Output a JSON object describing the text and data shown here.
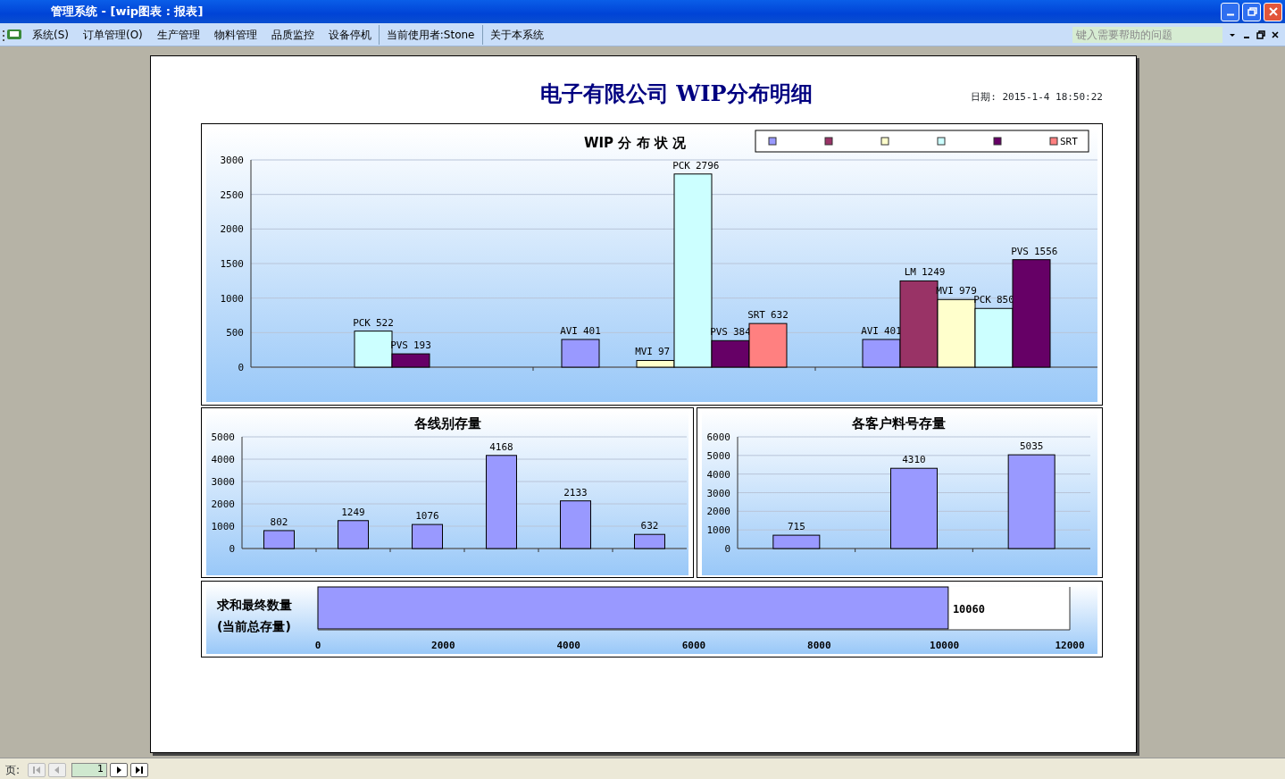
{
  "window": {
    "title": "管理系统 - [wip图表 : 报表]"
  },
  "menu": [
    {
      "label": "系统(S)",
      "kind": "item"
    },
    {
      "label": "订单管理(O)",
      "kind": "item"
    },
    {
      "label": "生产管理",
      "kind": "item"
    },
    {
      "label": "物料管理",
      "kind": "item"
    },
    {
      "label": "品质监控",
      "kind": "item"
    },
    {
      "label": "设备停机",
      "kind": "item"
    },
    {
      "label": "当前使用者:Stone",
      "kind": "sep-item"
    },
    {
      "label": "关于本系统",
      "kind": "sep-item"
    }
  ],
  "help": {
    "placeholder": "键入需要帮助的问题"
  },
  "report": {
    "title": "电子有限公司 WIP分布明细",
    "date": "日期: 2015-1-4 18:50:22",
    "wip_chart": {
      "legend_label": "SRT",
      "chart_data": {
        "type": "bar",
        "title": "WIP 分 布 状 况",
        "data_labels": true,
        "grid": true,
        "yticks": [
          0,
          500,
          1000,
          1500,
          2000,
          2500,
          3000
        ],
        "ylim": [
          0,
          3000
        ],
        "series": [
          {
            "name": "AVI",
            "color": "#9999ff",
            "values": [
              null,
              401,
              401
            ]
          },
          {
            "name": "LM",
            "color": "#993366",
            "values": [
              null,
              null,
              1249
            ]
          },
          {
            "name": "MVI",
            "color": "#ffffcc",
            "values": [
              null,
              97,
              979
            ]
          },
          {
            "name": "PCK",
            "color": "#ccffff",
            "values": [
              522,
              2796,
              850
            ]
          },
          {
            "name": "PVS",
            "color": "#660066",
            "values": [
              193,
              384,
              1556
            ]
          },
          {
            "name": "SRT",
            "color": "#ff8080",
            "values": [
              null,
              632,
              null
            ]
          }
        ]
      }
    },
    "line_chart": {
      "chart_data": {
        "type": "bar",
        "title": "各线别存量",
        "data_labels": true,
        "grid": true,
        "yticks": [
          0,
          1000,
          2000,
          3000,
          4000,
          5000
        ],
        "ylim": [
          0,
          5000
        ],
        "series": [
          {
            "color": "#9999ff",
            "values": [
              802,
              1249,
              1076,
              4168,
              2133,
              632
            ]
          }
        ]
      }
    },
    "customer_chart": {
      "chart_data": {
        "type": "bar",
        "title": "各客户料号存量",
        "data_labels": true,
        "grid": true,
        "yticks": [
          0,
          1000,
          2000,
          3000,
          4000,
          5000,
          6000
        ],
        "ylim": [
          0,
          6000
        ],
        "series": [
          {
            "color": "#9999ff",
            "values": [
              715,
              4310,
              5035
            ]
          }
        ]
      }
    },
    "total_chart": {
      "chart_data": {
        "type": "bar",
        "orientation": "horizontal",
        "categories": [
          "求和最终数量\n(当前总存量)"
        ],
        "data_labels": true,
        "xticks": [
          0,
          2000,
          4000,
          6000,
          8000,
          10000,
          12000
        ],
        "xlim": [
          0,
          12000
        ],
        "series": [
          {
            "color": "#9999ff",
            "values": [
              10060
            ]
          }
        ]
      }
    }
  },
  "pager": {
    "label": "页:",
    "page": "1"
  }
}
